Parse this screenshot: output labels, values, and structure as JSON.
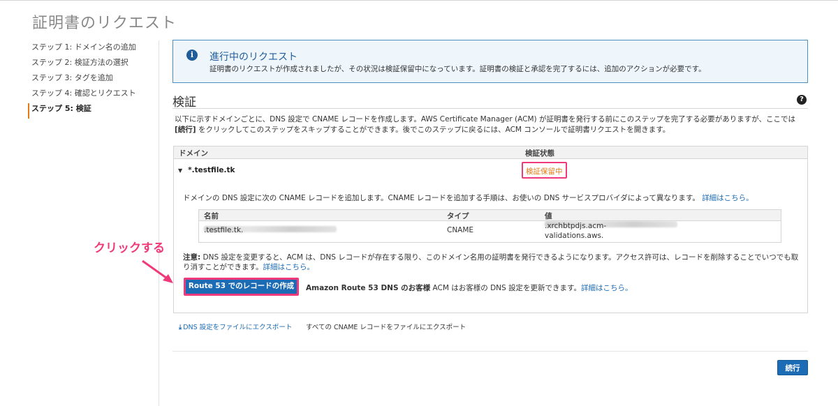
{
  "page": {
    "title": "証明書のリクエスト"
  },
  "steps": [
    {
      "label": "ステップ 1: ドメイン名の追加",
      "active": false
    },
    {
      "label": "ステップ 2: 検証方法の選択",
      "active": false
    },
    {
      "label": "ステップ 3: タグを追加",
      "active": false
    },
    {
      "label": "ステップ 4: 確認とリクエスト",
      "active": false
    },
    {
      "label": "ステップ 5: 検証",
      "active": true
    }
  ],
  "info": {
    "icon": "info-icon",
    "title": "進行中のリクエスト",
    "body": "証明書のリクエストが作成されましたが、その状況は検証保留中になっています。証明書の検証と承認を完了するには、追加のアクションが必要です。"
  },
  "section": {
    "title": "検証",
    "desc_part1": "以下に示すドメインごとに、DNS 設定で CNAME レコードを作成します。AWS Certificate Manager (ACM) が証明書を発行する前にこのステップを完了する必要がありますが、ここでは ",
    "desc_bold": "[続行]",
    "desc_part2": " をクリックしてこのステップをスキップすることができます。後でこのステップに戻るには、ACM コンソールで証明書リクエストを開きます。"
  },
  "domain_table": {
    "headers": {
      "domain": "ドメイン",
      "status": "検証状態"
    },
    "domain": "*.testfile.tk",
    "status": "検証保留中",
    "cname_note": "ドメインの DNS 設定に次の CNAME レコードを追加します。CNAME レコードを追加する手順は、お使いの DNS サービスプロバイダによって異なります。",
    "details_link": "詳細はこちら。"
  },
  "record_table": {
    "headers": {
      "name": "名前",
      "type": "タイプ",
      "value": "値"
    },
    "name_suffix": ".testfile.tk.",
    "type": "CNAME",
    "value_line1": ".xrchbtpdjs.acm-",
    "value_line2": "validations.aws."
  },
  "note": {
    "label": "注意:",
    "text": " DNS 設定を変更すると、ACM は、DNS レコードが存在する限り、このドメイン名用の証明書を発行できるようになります。アクセス許可は、レコードを削除することでいつでも取り消すことができます。",
    "link": "詳細はこちら。"
  },
  "route53": {
    "button": "Route 53 でのレコードの作成",
    "desc_bold": "Amazon Route 53 DNS のお客様",
    "desc": " ACM はお客様の DNS 設定を更新できます。",
    "link": "詳細はこちら。"
  },
  "annotation": {
    "text": "クリックする",
    "color": "#f0397a"
  },
  "export": {
    "icon": "download-icon",
    "link": "DNS 設定をファイルにエクスポート",
    "desc": "すべての CNAME レコードをファイルにエクスポート"
  },
  "footer": {
    "continue": "続行"
  },
  "colors": {
    "accent": "#1b6bb5",
    "pending": "#e07b17",
    "highlight": "#f0397a"
  }
}
